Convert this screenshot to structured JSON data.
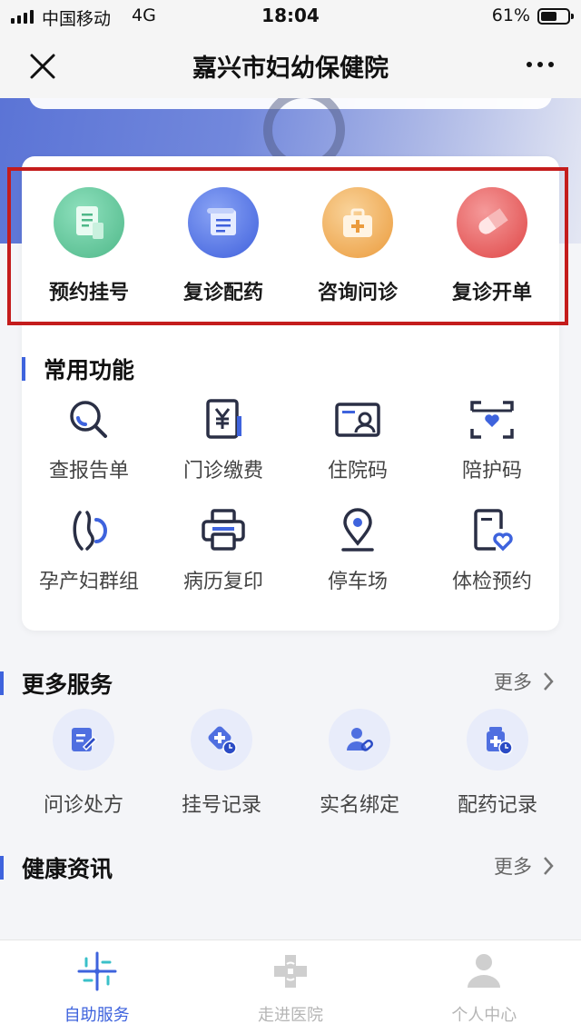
{
  "status_bar": {
    "carrier": "中国移动",
    "network": "4G",
    "time": "18:04",
    "battery": "61%",
    "battery_level": 0.61
  },
  "nav": {
    "title": "嘉兴市妇幼保健院",
    "close_icon": "close-icon",
    "more_icon": "more-dots-icon"
  },
  "top_services": [
    {
      "label": "预约挂号",
      "icon": "registration-document-icon",
      "color": "#5ec49a"
    },
    {
      "label": "复诊配药",
      "icon": "prescription-scroll-icon",
      "color": "#4f6fe0"
    },
    {
      "label": "咨询问诊",
      "icon": "medical-kit-icon",
      "color": "#f0a64a"
    },
    {
      "label": "复诊开单",
      "icon": "pill-capsule-icon",
      "color": "#e8504f"
    }
  ],
  "common_functions": {
    "title": "常用功能",
    "items": [
      {
        "label": "查报告单",
        "icon": "magnifier-icon"
      },
      {
        "label": "门诊缴费",
        "icon": "yen-payment-icon"
      },
      {
        "label": "住院码",
        "icon": "id-card-icon"
      },
      {
        "label": "陪护码",
        "icon": "scan-heart-icon"
      },
      {
        "label": "孕产妇群组",
        "icon": "pregnancy-icon"
      },
      {
        "label": "病历复印",
        "icon": "printer-icon"
      },
      {
        "label": "停车场",
        "icon": "location-pin-icon"
      },
      {
        "label": "体检预约",
        "icon": "checkup-heart-icon"
      }
    ]
  },
  "more_services": {
    "title": "更多服务",
    "more_label": "更多",
    "items": [
      {
        "label": "问诊处方",
        "icon": "edit-prescription-icon"
      },
      {
        "label": "挂号记录",
        "icon": "registration-history-icon"
      },
      {
        "label": "实名绑定",
        "icon": "user-link-icon"
      },
      {
        "label": "配药记录",
        "icon": "medicine-history-icon"
      }
    ]
  },
  "health_news": {
    "title": "健康资讯",
    "more_label": "更多"
  },
  "tab_bar": {
    "accent": "#3e63dd",
    "items": [
      {
        "label": "自助服务",
        "icon": "self-service-icon",
        "active": true
      },
      {
        "label": "走进医院",
        "icon": "hospital-cross-icon",
        "active": false
      },
      {
        "label": "个人中心",
        "icon": "person-icon",
        "active": false
      }
    ]
  }
}
